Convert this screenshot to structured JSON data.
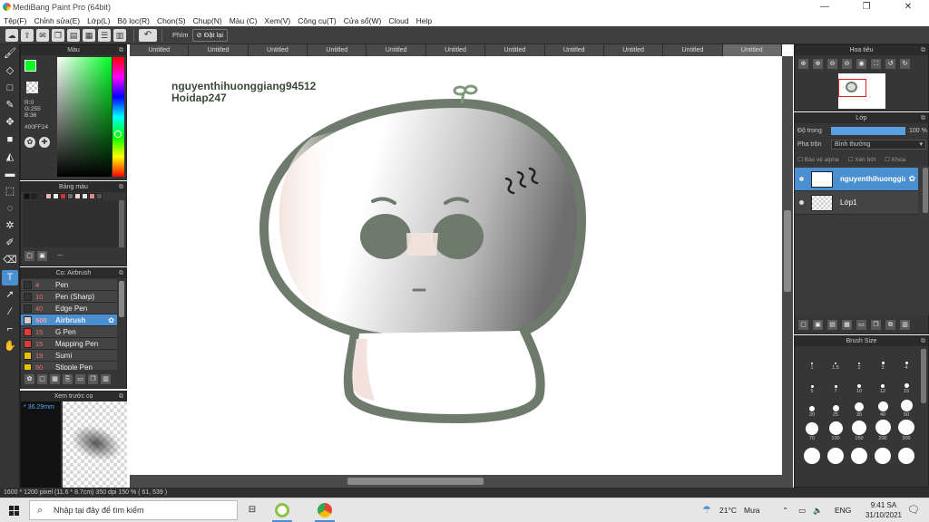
{
  "titlebar": {
    "title": "MediBang Paint Pro (64bit)",
    "min": "—",
    "max": "❐",
    "close": "✕"
  },
  "menu": [
    "Tệp(F)",
    "Chỉnh sửa(E)",
    "Lớp(L)",
    "Bộ lọc(R)",
    "Chọn(S)",
    "Chụp(N)",
    "Màu (C)",
    "Xem(V)",
    "Công cụ(T)",
    "Cửa sổ(W)",
    "Cloud",
    "Help"
  ],
  "toolbar": {
    "hotkey_label": "Phím",
    "reset_label": "Đặt lại"
  },
  "color_panel": {
    "title": "Màu",
    "r": "R:0",
    "g": "G:255",
    "b": "B:36",
    "hex": "#00FF24",
    "primary": "#00ff24"
  },
  "palette_panel": {
    "title": "Bảng màu",
    "more": "---",
    "swatches": [
      "#111111",
      "#222222",
      "#333333",
      "#e6b8b8",
      "#f0f0f0",
      "#c73737",
      "#6b6b6b",
      "#f4d4d4",
      "#e8e8e8",
      "#dd8888",
      "#555555"
    ]
  },
  "brush_panel": {
    "title": "Cọ: Airbrush",
    "items": [
      {
        "size": "4",
        "name": "Pen",
        "color": "#333333"
      },
      {
        "size": "10",
        "name": "Pen (Sharp)",
        "color": "#333333"
      },
      {
        "size": "40",
        "name": "Edge Pen",
        "color": "#333333"
      },
      {
        "size": "500",
        "name": "Airbrush",
        "color": "#cfcfcf",
        "selected": true
      },
      {
        "size": "15",
        "name": "G Pen",
        "color": "#e03a3a"
      },
      {
        "size": "15",
        "name": "Mapping Pen",
        "color": "#e03a3a"
      },
      {
        "size": "19",
        "name": "Sumi",
        "color": "#e8c400"
      },
      {
        "size": "50",
        "name": "Stipple Pen",
        "color": "#e8c400"
      }
    ]
  },
  "preview_panel": {
    "title": "Xem trước cọ",
    "size": "36.29mm"
  },
  "tabs": [
    "Untitled",
    "Untitled",
    "Untitled",
    "Untitled",
    "Untitled",
    "Untitled",
    "Untitled",
    "Untitled",
    "Untitled",
    "Untitled",
    "Untitled"
  ],
  "canvas": {
    "watermark_user": "nguyenthihuonggiang94512",
    "watermark_site": "Hoidap247"
  },
  "navigator": {
    "title": "Hoa tiêu"
  },
  "layer_panel": {
    "title": "Lớp",
    "opacity_label": "Độ trong",
    "opacity_value": "100 %",
    "blend_label": "Pha trộn",
    "blend_value": "Bình thường",
    "protect_alpha": "Bảo vệ alpha",
    "clipping": "Xén bớt",
    "lock": "Khóa",
    "opacity": 1.0,
    "layers": [
      {
        "name": "nguyenthihuonggiang94512",
        "selected": true
      },
      {
        "name": "Lớp1",
        "selected": false
      }
    ]
  },
  "brush_size": {
    "title": "Brush Size",
    "sizes": [
      "1",
      "1.5",
      "2",
      "3",
      "4",
      "5",
      "7",
      "10",
      "12",
      "15",
      "20",
      "25",
      "30",
      "40",
      "50",
      "70",
      "100",
      "150",
      "200",
      "300",
      "",
      "",
      "",
      "",
      ""
    ]
  },
  "statusbar": {
    "text": "1600 * 1200 pixel    (11.6 * 8.7cm)   350 dpi   150 %   ( 61, 539 )"
  },
  "taskbar": {
    "search_placeholder": "Nhập tại đây để tìm kiếm",
    "weather_temp": "21°C",
    "weather_text": "Mưa",
    "lang": "ENG",
    "time": "9:41 SA",
    "date": "31/10/2021"
  }
}
